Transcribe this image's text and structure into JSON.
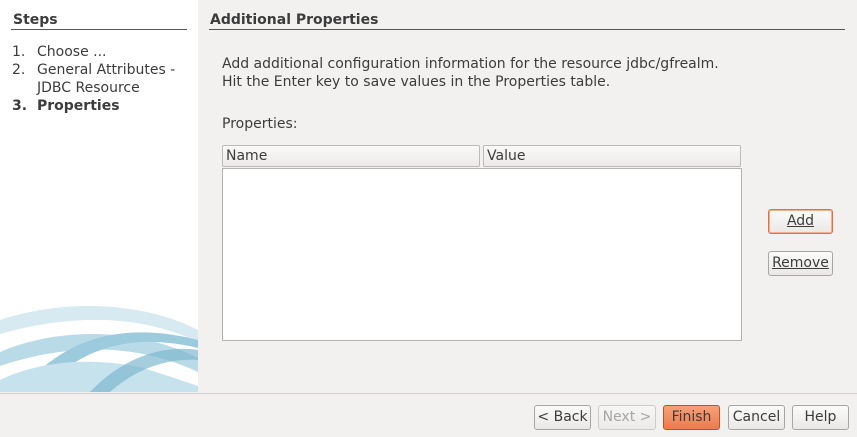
{
  "steps": {
    "title": "Steps",
    "items": [
      {
        "num": "1.",
        "label": "Choose ..."
      },
      {
        "num": "2.",
        "label": "General Attributes - JDBC Resource"
      },
      {
        "num": "3.",
        "label": "Properties"
      }
    ]
  },
  "panel": {
    "title": "Additional Properties",
    "desc_line1": "Add additional configuration information for the resource jdbc/gfrealm.",
    "desc_line2": "Hit the Enter key to save values in the Properties table.",
    "properties_label": "Properties:",
    "table": {
      "columns": [
        "Name",
        "Value"
      ],
      "rows": []
    },
    "add_label": "Add",
    "remove_label": "Remove"
  },
  "footer": {
    "back_label": "< Back",
    "next_label": "Next >",
    "finish_label": "Finish",
    "cancel_label": "Cancel",
    "help_label": "Help"
  },
  "colors": {
    "accent": "#ec7c4c",
    "focus_border": "#e07040"
  }
}
